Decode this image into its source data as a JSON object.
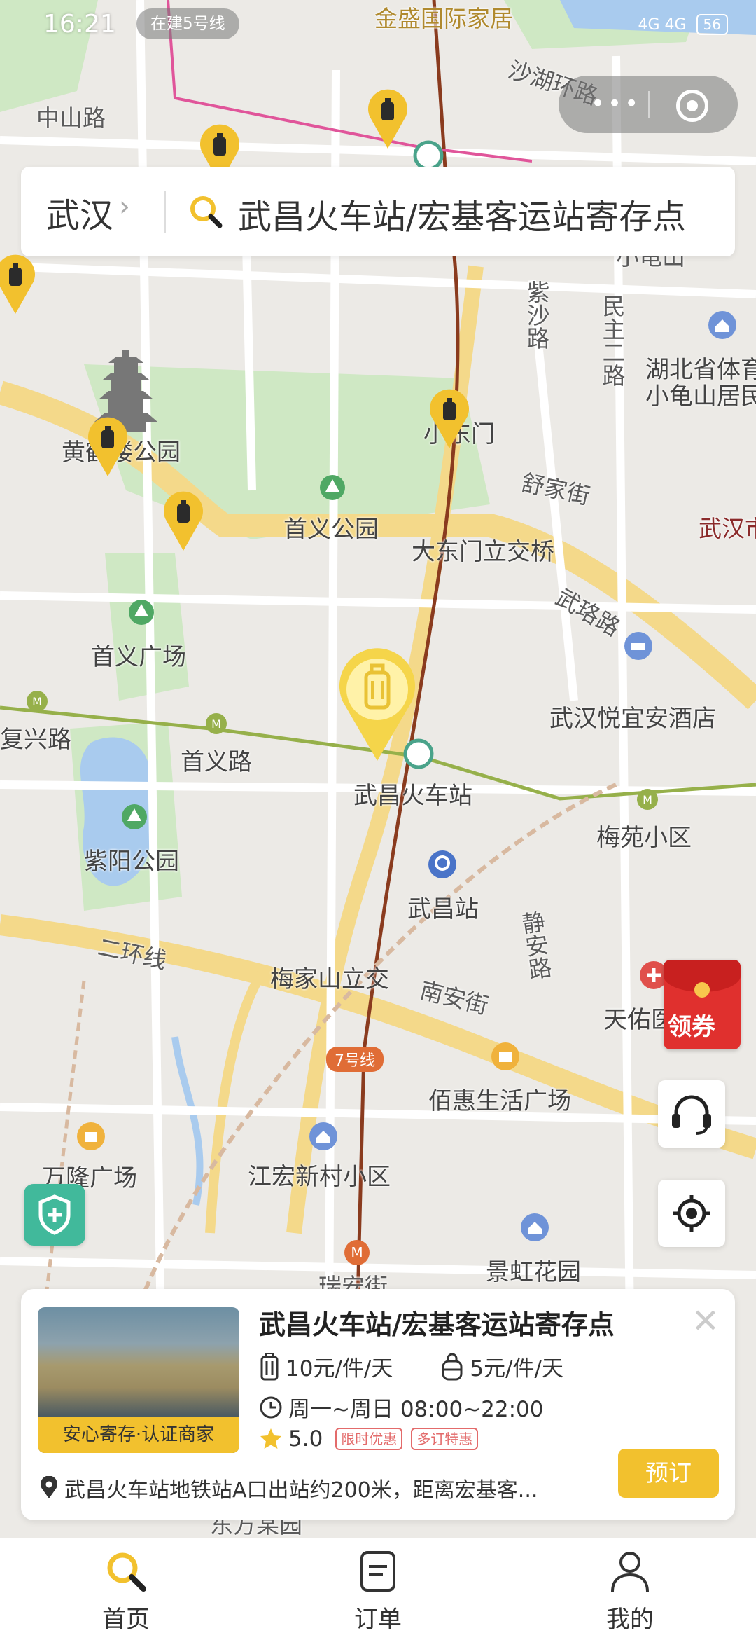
{
  "status_bar": {
    "time": "16:21",
    "pill": "在建5号线",
    "signal": "4G 4G",
    "battery": "56"
  },
  "search": {
    "city": "武汉",
    "query": "武昌火车站/宏基客运站寄存点"
  },
  "map_labels": [
    "金盛国际家居",
    "沙湖环路",
    "中山路",
    "小龟山",
    "紫沙路",
    "民主二路",
    "湖北省体育",
    "小龟山居民",
    "黄鹤楼公园",
    "小东门",
    "舒家街",
    "首义公园",
    "大东门立交桥",
    "武汉市",
    "武珞路",
    "首义广场",
    "复兴路",
    "首义路",
    "武汉悦宜安酒店",
    "武昌火车站",
    "梅苑小区",
    "紫阳公园",
    "武昌站",
    "二环线",
    "梅家山立交",
    "南安街",
    "静安路",
    "天佑医",
    "7号线",
    "佰惠生活广场",
    "万隆广场",
    "江宏新村小区",
    "景虹花园",
    "瑞安街",
    "东方某园"
  ],
  "floating": {
    "coupon_label": "领券"
  },
  "card": {
    "title": "武昌火车站/宏基客运站寄存点",
    "badge": "安心寄存·认证商家",
    "price_large": "10元/件/天",
    "price_small": "5元/件/天",
    "hours": "周一~周日 08:00~22:00",
    "rating": "5.0",
    "tags": [
      "限时优惠",
      "多订特惠"
    ],
    "address": "武昌火车站地铁站A口出站约200米，距离宏基客...",
    "book_label": "预订"
  },
  "tabs": [
    {
      "label": "首页"
    },
    {
      "label": "订单"
    },
    {
      "label": "我的"
    }
  ],
  "colors": {
    "accent": "#f2c12e",
    "map_bg": "#eceae6",
    "park": "#cfe8c4",
    "water": "#a9cbee"
  }
}
